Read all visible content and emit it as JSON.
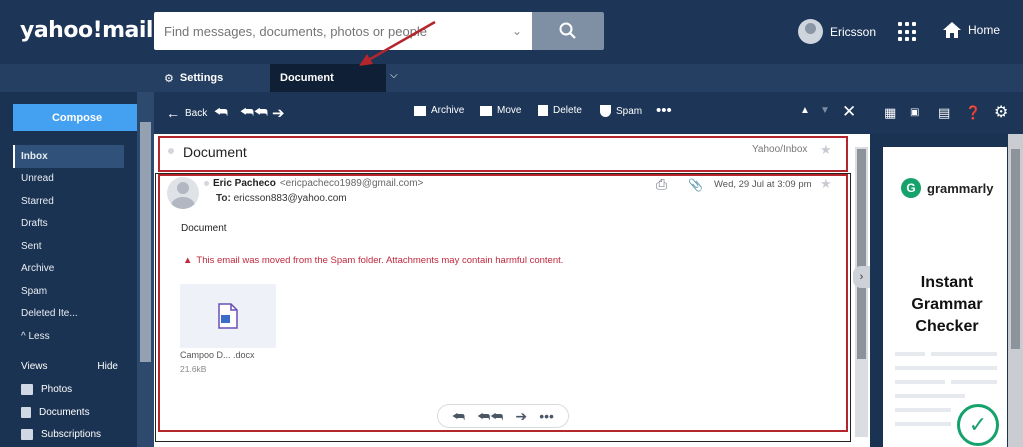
{
  "brand": {
    "logo_text": "yahoo!mail"
  },
  "search": {
    "placeholder": "Find messages, documents, photos or people"
  },
  "user": {
    "name": "Ericsson"
  },
  "home_label": "Home",
  "tabs": [
    {
      "label": "Settings",
      "icon": "gear-icon"
    },
    {
      "label": "Document"
    }
  ],
  "toolbar": {
    "back_label": "Back",
    "archive_label": "Archive",
    "move_label": "Move",
    "delete_label": "Delete",
    "spam_label": "Spam"
  },
  "sidebar": {
    "compose_label": "Compose",
    "items": [
      {
        "label": "Inbox",
        "active": true
      },
      {
        "label": "Unread"
      },
      {
        "label": "Starred"
      },
      {
        "label": "Drafts"
      },
      {
        "label": "Sent"
      },
      {
        "label": "Archive"
      },
      {
        "label": "Spam"
      },
      {
        "label": "Deleted Ite..."
      },
      {
        "label": "^ Less"
      }
    ],
    "views_label": "Views",
    "hide_label": "Hide",
    "views": [
      {
        "label": "Photos",
        "icon": "photo-icon"
      },
      {
        "label": "Documents",
        "icon": "document-icon"
      },
      {
        "label": "Subscriptions",
        "icon": "subscriptions-icon"
      }
    ]
  },
  "message": {
    "subject": "Document",
    "folder": "Yahoo/Inbox",
    "sender_name": "Eric Pacheco",
    "sender_email": "<ericpacheco1989@gmail.com>",
    "to_label": "To:",
    "to_address": "ericsson883@yahoo.com",
    "date": "Wed, 29 Jul at 3:09 pm",
    "body": "Document",
    "warning": "This email was moved from the Spam folder. Attachments may contain harmful content.",
    "attachment_name": "Campoo D... .docx",
    "attachment_size": "21.6kB"
  },
  "ad": {
    "brand": "grammarly",
    "headline_lines": [
      "Instant",
      "Grammar",
      "Checker"
    ]
  },
  "colors": {
    "header_bg": "#1d3557",
    "compose_bg": "#44a0f0",
    "warning_text": "#c0283d",
    "annotation_red": "#b5262c",
    "grammarly_green": "#15a26d"
  }
}
